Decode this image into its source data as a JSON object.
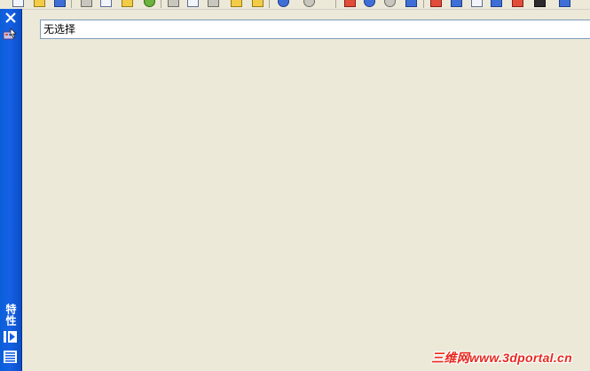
{
  "toolbar": {
    "icons": [
      "new-icon",
      "open-icon",
      "save-icon",
      "plot-icon",
      "preview-icon",
      "publish-icon",
      "globe-icon",
      "cut-icon",
      "copy-icon",
      "paste-icon",
      "match-icon",
      "brush-icon",
      "undo-icon",
      "redo-icon",
      "pan-icon",
      "zoom-icon",
      "orbit-icon",
      "properties-icon",
      "design-center-icon",
      "tool-palette-icon",
      "sheet-set-icon",
      "markup-icon",
      "calculator-icon",
      "help-icon"
    ]
  },
  "palette": {
    "title": "特性",
    "close_icon": "close-icon",
    "quick_select_icon": "quick-select-icon",
    "autohide_icon": "autohide-icon",
    "menu_icon": "properties-menu-icon"
  },
  "selection": {
    "value": "无选择"
  },
  "watermark": {
    "text": "三维网www.3dportal.cn"
  },
  "colors": {
    "palette_blue": "#1660e6",
    "background": "#ece9d8",
    "watermark_red": "#e8291f"
  }
}
